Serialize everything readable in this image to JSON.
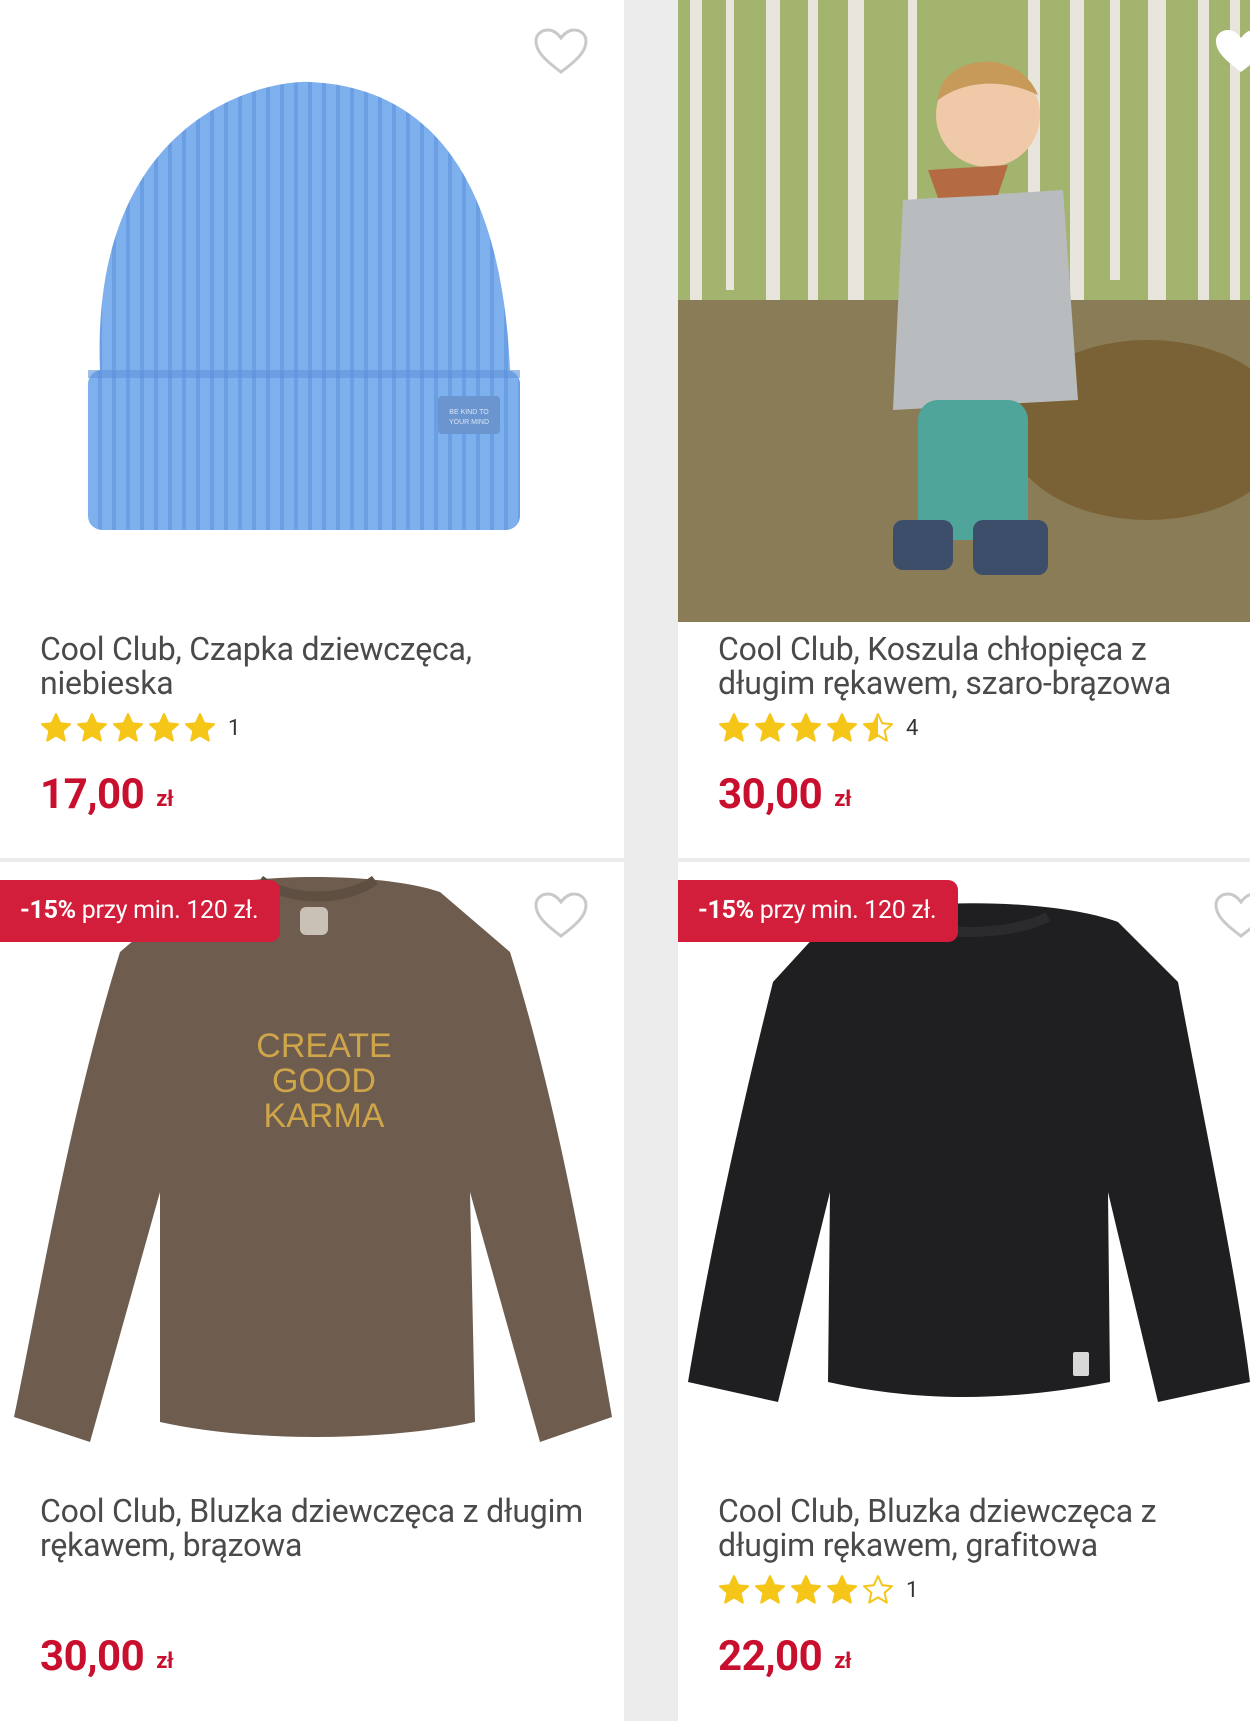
{
  "products": [
    {
      "title": "Cool Club, Czapka dziewczęca, niebieska",
      "image_desc_icon": "beanie-image",
      "rating_value": 5,
      "rating_count": "1",
      "price": "17,00",
      "currency": "zł",
      "badge": null
    },
    {
      "title": "Cool Club, Koszula chłopięca z długim rękawem, szaro-brązowa",
      "image_desc_icon": "child-in-forest-image",
      "rating_value": 4.5,
      "rating_count": "4",
      "price": "30,00",
      "currency": "zł",
      "badge": null
    },
    {
      "title": "Cool Club, Bluzka dziewczęca z długim rękawem, brązowa",
      "image_desc_icon": "brown-sweatshirt-image",
      "print_text": [
        "CREATE",
        "GOOD",
        "KARMA"
      ],
      "rating_value": null,
      "rating_count": null,
      "price": "30,00",
      "currency": "zł",
      "badge": {
        "pct": "-15%",
        "text": " przy min. 120 zł."
      }
    },
    {
      "title": "Cool Club, Bluzka dziewczęca z długim rękawem, grafitowa",
      "image_desc_icon": "black-longsleeve-image",
      "rating_value": 4,
      "rating_count": "1",
      "price": "22,00",
      "currency": "zł",
      "badge": {
        "pct": "-15%",
        "text": " przy min. 120 zł."
      }
    }
  ],
  "colors": {
    "price": "#c8102e",
    "badge": "#d21e3a",
    "star": "#f5c518"
  }
}
